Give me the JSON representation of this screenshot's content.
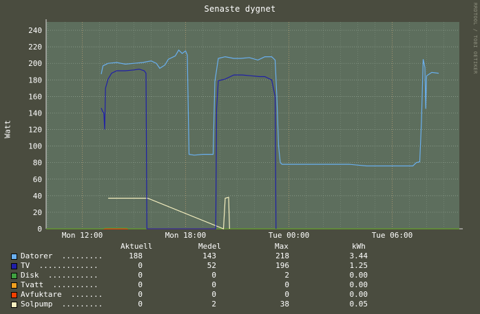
{
  "title": "Senaste dygnet",
  "watermark": "RRDTOOL / TOBI OETIKER",
  "legend": {
    "headers": [
      "Aktuell",
      "Medel",
      "Max",
      "kWh"
    ],
    "rows": [
      {
        "name": "Datorer  .........",
        "color": "#6ab0f0",
        "aktuell": "188",
        "medel": "143",
        "max": "218",
        "kwh": "3.44"
      },
      {
        "name": "TV  .............",
        "color": "#1f1fa8",
        "aktuell": "0",
        "medel": "52",
        "max": "196",
        "kwh": "1.25"
      },
      {
        "name": "Disk  ...........",
        "color": "#3fa040",
        "aktuell": "0",
        "medel": "0",
        "max": "2",
        "kwh": "0.00"
      },
      {
        "name": "Tvatt  ..........",
        "color": "#f0a020",
        "aktuell": "0",
        "medel": "0",
        "max": "0",
        "kwh": "0.00"
      },
      {
        "name": "Avfuktare  .......",
        "color": "#f04000",
        "aktuell": "0",
        "medel": "0",
        "max": "0",
        "kwh": "0.00"
      },
      {
        "name": "Solpump  .........",
        "color": "#f6f0c0",
        "aktuell": "0",
        "medel": "2",
        "max": "38",
        "kwh": "0.05"
      }
    ]
  },
  "chart_data": {
    "type": "line",
    "title": "Senaste dygnet",
    "xlabel": "",
    "ylabel": "Watt",
    "ylim": [
      0,
      250
    ],
    "xlim": [
      9.9,
      33.9
    ],
    "x_unit": "hours after Mon 00:00",
    "yticks": [
      0,
      20,
      40,
      60,
      80,
      100,
      120,
      140,
      160,
      180,
      200,
      220,
      240
    ],
    "xticks": [
      {
        "x": 12,
        "label": "Mon 12:00"
      },
      {
        "x": 18,
        "label": "Mon 18:00"
      },
      {
        "x": 24,
        "label": "Tue 00:00"
      },
      {
        "x": 30,
        "label": "Tue 06:00"
      }
    ],
    "grid": true,
    "background": "#5d6e5d",
    "series": [
      {
        "name": "Datorer",
        "color": "#6ab0f0",
        "points": [
          [
            13.1,
            187
          ],
          [
            13.2,
            197
          ],
          [
            13.5,
            200
          ],
          [
            14.0,
            201
          ],
          [
            14.5,
            199
          ],
          [
            15.0,
            200
          ],
          [
            15.5,
            201
          ],
          [
            16.0,
            203
          ],
          [
            16.3,
            200
          ],
          [
            16.5,
            194
          ],
          [
            16.8,
            198
          ],
          [
            17.0,
            205
          ],
          [
            17.4,
            209
          ],
          [
            17.6,
            216
          ],
          [
            17.8,
            212
          ],
          [
            18.0,
            215
          ],
          [
            18.1,
            210
          ],
          [
            18.2,
            90
          ],
          [
            18.5,
            89
          ],
          [
            19.0,
            90
          ],
          [
            19.5,
            90
          ],
          [
            19.6,
            90
          ],
          [
            19.7,
            178
          ],
          [
            19.9,
            206
          ],
          [
            20.3,
            208
          ],
          [
            20.8,
            206
          ],
          [
            21.2,
            206
          ],
          [
            21.7,
            207
          ],
          [
            22.2,
            204
          ],
          [
            22.6,
            208
          ],
          [
            23.0,
            208
          ],
          [
            23.2,
            204
          ],
          [
            23.3,
            160
          ],
          [
            23.4,
            100
          ],
          [
            23.5,
            80
          ],
          [
            23.6,
            78
          ],
          [
            24.5,
            78
          ],
          [
            25.5,
            78
          ],
          [
            26.5,
            78
          ],
          [
            27.5,
            78
          ],
          [
            28.0,
            77
          ],
          [
            28.5,
            76
          ],
          [
            29.0,
            76
          ],
          [
            29.5,
            76
          ],
          [
            30.0,
            76
          ],
          [
            30.5,
            76
          ],
          [
            30.8,
            76
          ],
          [
            31.2,
            76
          ],
          [
            31.4,
            80
          ],
          [
            31.6,
            81
          ],
          [
            31.7,
            130
          ],
          [
            31.8,
            205
          ],
          [
            31.9,
            195
          ],
          [
            31.95,
            145
          ],
          [
            32.0,
            185
          ],
          [
            32.3,
            189
          ],
          [
            32.7,
            188
          ]
        ]
      },
      {
        "name": "TV",
        "color": "#1f1fa8",
        "points": [
          [
            13.1,
            146
          ],
          [
            13.2,
            141
          ],
          [
            13.25,
            140
          ],
          [
            13.3,
            120
          ],
          [
            13.35,
            170
          ],
          [
            13.5,
            181
          ],
          [
            13.7,
            188
          ],
          [
            14.0,
            191
          ],
          [
            14.5,
            191
          ],
          [
            15.0,
            192
          ],
          [
            15.3,
            193
          ],
          [
            15.6,
            191
          ],
          [
            15.7,
            188
          ],
          [
            15.75,
            0
          ],
          [
            19.75,
            0
          ],
          [
            19.8,
            145
          ],
          [
            19.9,
            179
          ],
          [
            20.3,
            181
          ],
          [
            20.8,
            186
          ],
          [
            21.3,
            186
          ],
          [
            21.8,
            185
          ],
          [
            22.3,
            184
          ],
          [
            22.6,
            184
          ],
          [
            23.0,
            180
          ],
          [
            23.2,
            160
          ],
          [
            23.25,
            0
          ]
        ]
      },
      {
        "name": "Disk",
        "color": "#3fa040",
        "points": [
          [
            9.9,
            0
          ],
          [
            13.2,
            0
          ],
          [
            13.3,
            1
          ],
          [
            14.6,
            1
          ],
          [
            14.7,
            0
          ],
          [
            33.9,
            0
          ]
        ]
      },
      {
        "name": "Tvatt",
        "color": "#f0a020",
        "points": [
          [
            9.9,
            0
          ],
          [
            33.9,
            0
          ]
        ]
      },
      {
        "name": "Avfuktare",
        "color": "#f04000",
        "points": [
          [
            9.9,
            0
          ],
          [
            33.9,
            0
          ]
        ]
      },
      {
        "name": "Solpump",
        "color": "#f6f0c0",
        "points": [
          [
            13.5,
            37
          ],
          [
            13.8,
            37
          ],
          [
            15.5,
            37
          ],
          [
            15.8,
            37
          ],
          [
            20.2,
            0
          ],
          [
            20.3,
            37
          ],
          [
            20.5,
            38
          ],
          [
            20.55,
            0
          ]
        ]
      }
    ]
  }
}
